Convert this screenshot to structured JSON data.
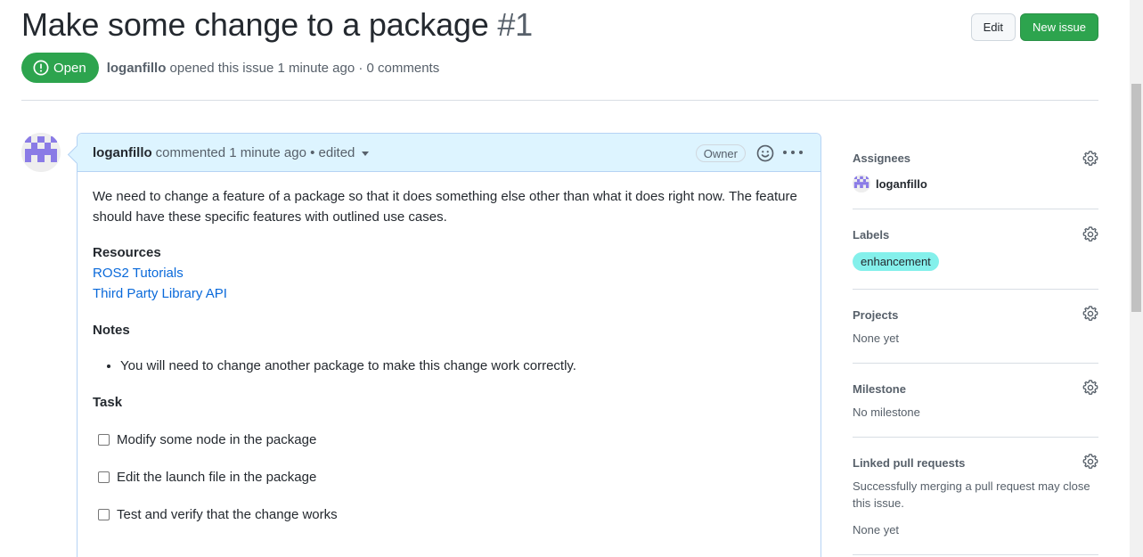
{
  "issue": {
    "title": "Make some change to a package",
    "number": "#1",
    "state": "Open",
    "author": "loganfillo",
    "meta_text": "opened this issue 1 minute ago · 0 comments"
  },
  "header_actions": {
    "edit_label": "Edit",
    "new_issue_label": "New issue"
  },
  "comment": {
    "author": "loganfillo",
    "header_text": "commented 1 minute ago • edited",
    "owner_badge": "Owner",
    "intro": "We need to change a feature of a package so that it does something else other than what it does right now. The feature should have these specific features with outlined use cases.",
    "resources_heading": "Resources",
    "links": [
      "ROS2 Tutorials",
      "Third Party Library API"
    ],
    "notes_heading": "Notes",
    "notes": [
      "You will need to change another package to make this change work correctly."
    ],
    "task_heading": "Task",
    "tasks": [
      {
        "label": "Modify some node in the package",
        "checked": false
      },
      {
        "label": "Edit the launch file in the package",
        "checked": false
      },
      {
        "label": "Test and verify that the change works",
        "checked": false
      }
    ]
  },
  "sidebar": {
    "assignees": {
      "title": "Assignees",
      "user": "loganfillo"
    },
    "labels": {
      "title": "Labels",
      "items": [
        {
          "name": "enhancement",
          "color": "#84f0eb"
        }
      ]
    },
    "projects": {
      "title": "Projects",
      "value": "None yet"
    },
    "milestone": {
      "title": "Milestone",
      "value": "No milestone"
    },
    "linked_prs": {
      "title": "Linked pull requests",
      "description": "Successfully merging a pull request may close this issue.",
      "value": "None yet"
    }
  },
  "colors": {
    "open_green": "#2da44e",
    "link_blue": "#0969da",
    "comment_header_bg": "#ddf4ff",
    "avatar_purple": "#8a7be6"
  },
  "icons": [
    "issue-open-icon",
    "smiley-icon",
    "kebab-horizontal-icon",
    "gear-icon",
    "triangle-down-icon"
  ]
}
